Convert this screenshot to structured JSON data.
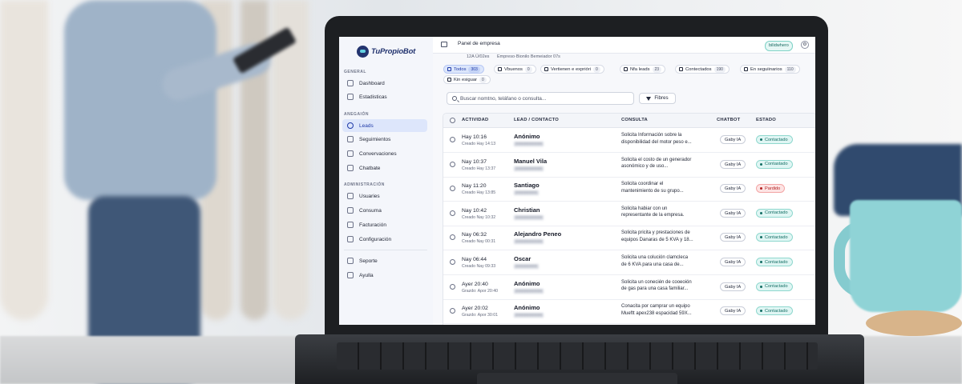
{
  "brand": {
    "logo_text": "TuPropioBot"
  },
  "sidebar": {
    "sections": [
      {
        "label": "GENERAL",
        "items": [
          {
            "label": "Dashboard",
            "icon": "grid-icon"
          },
          {
            "label": "Estadisticas",
            "icon": "bar-chart-icon"
          }
        ]
      },
      {
        "label": "ANEGAIÓN",
        "items": [
          {
            "label": "Leads",
            "icon": "user-icon",
            "active": true
          },
          {
            "label": "Seguimientos",
            "icon": "clock-icon"
          },
          {
            "label": "Convervaciones",
            "icon": "chat-icon"
          },
          {
            "label": "Chatbate",
            "icon": "eye-icon"
          }
        ]
      },
      {
        "label": "ADMINISTRACIÓN",
        "items": [
          {
            "label": "Usuaries",
            "icon": "users-icon"
          },
          {
            "label": "Consuma",
            "icon": "gauge-icon"
          },
          {
            "label": "Facturación",
            "icon": "card-icon"
          },
          {
            "label": "Configuración",
            "icon": "gear-icon"
          }
        ]
      }
    ],
    "footer": [
      {
        "label": "Seporte",
        "icon": "support-icon"
      },
      {
        "label": "Ayulla",
        "icon": "help-icon"
      }
    ]
  },
  "topbar": {
    "title": "Panel de empresa",
    "user_badge": "bilidwhero",
    "subtitle_left": "12A Ú/02es",
    "subtitle_right": "Empreso·Bionilo Bemeiador 07s"
  },
  "filters": [
    {
      "label": "Todos",
      "count": "303",
      "active": true
    },
    {
      "label": "Vbuenos",
      "count": "0"
    },
    {
      "label": "Vertienen e exprióri",
      "count": "0"
    },
    {
      "label": "Nfa leads",
      "count": "23"
    },
    {
      "label": "Contectados",
      "count": "190"
    },
    {
      "label": "En seguiinarios",
      "count": "110"
    },
    {
      "label": "Kin esiguar",
      "count": "0"
    }
  ],
  "search": {
    "placeholder": "Buscar nomtno, teláfano o consulta...",
    "filter_label": "Fibres"
  },
  "table": {
    "headers": {
      "actividad": "ACTIVIDAD",
      "lead": "LEAD / CONTACTO",
      "consulta": "CONSULTA",
      "chatbot": "CHATBOT",
      "estado": "ESTADO"
    },
    "rows": [
      {
        "time": "Hay 10:16",
        "created": "Creado Hay 14:13",
        "name": "Anónimo",
        "phone": "●●●●●●●●●●",
        "consulta": [
          "Solicita Información sobre la",
          "disponibilidad del motor peso e..."
        ],
        "bot": "Gaby IA",
        "status": "Contactado",
        "status_type": "ok"
      },
      {
        "time": "Nay 10:37",
        "created": "Creado Hay 13:37",
        "name": "Manuel Vila",
        "phone": "●●●●●●●●●●",
        "consulta": [
          "Solicita el costo de un generador",
          "asonómico y de uso..."
        ],
        "bot": "Gaby IA",
        "status": "Contastado",
        "status_type": "ok"
      },
      {
        "time": "Nay 11:20",
        "created": "Creado Hay 13:85",
        "name": "Santiago",
        "phone": "●●●●●●●●",
        "consulta": [
          "Solicita coordinar el",
          "mantenimiento de su grupo..."
        ],
        "bot": "Gaby IA",
        "status": "Pardido",
        "status_type": "bad"
      },
      {
        "time": "Nay 10:42",
        "created": "Creado Nay 10:32",
        "name": "Christian",
        "phone": "●●●●●●●●●●",
        "consulta": [
          "Solicita habiar con un",
          "representante de la empresa."
        ],
        "bot": "Gaby IA",
        "status": "Contactado",
        "status_type": "ok"
      },
      {
        "time": "Nay 06:32",
        "created": "Creado Nay 00:31",
        "name": "Alejandro Peneo",
        "phone": "●●●●●●●●●●",
        "consulta": [
          "Solicita pricita y prestaciones de",
          "equipos Danaras de 5 KVA y 18..."
        ],
        "bot": "Gaby IA",
        "status": "Contactado",
        "status_type": "ok"
      },
      {
        "time": "Nay 06:44",
        "created": "Creado Nay 09:33",
        "name": "Oscar",
        "phone": "●●●●●●●●",
        "consulta": [
          "Solicita una colución clamcleca",
          "de 6 KVA para una casa de..."
        ],
        "bot": "Gaby IA",
        "status": "Contactado",
        "status_type": "ok"
      },
      {
        "time": "Ayer 20:40",
        "created": "Grazdo: Apor 20:40",
        "name": "Anónimo",
        "phone": "●●●●●●●●●●",
        "consulta": [
          "Solicita un conecién de cooeoión",
          "de gas para una casa familiar..."
        ],
        "bot": "Gaby IA",
        "status": "Contactado",
        "status_type": "ok"
      },
      {
        "time": "Ayer 20:02",
        "created": "Grazdo: Apor 30:01",
        "name": "Anónimo",
        "phone": "●●●●●●●●●●",
        "consulta": [
          "Conacita por camprar un equipo",
          "Mueftt apex238 espacidad 59X..."
        ],
        "bot": "Gaby IA",
        "status": "Contactado",
        "status_type": "ok"
      }
    ]
  },
  "colors": {
    "accent": "#1f3aa8",
    "contactado": "#136e64",
    "perdido": "#b42323",
    "brand": "#23346f"
  }
}
